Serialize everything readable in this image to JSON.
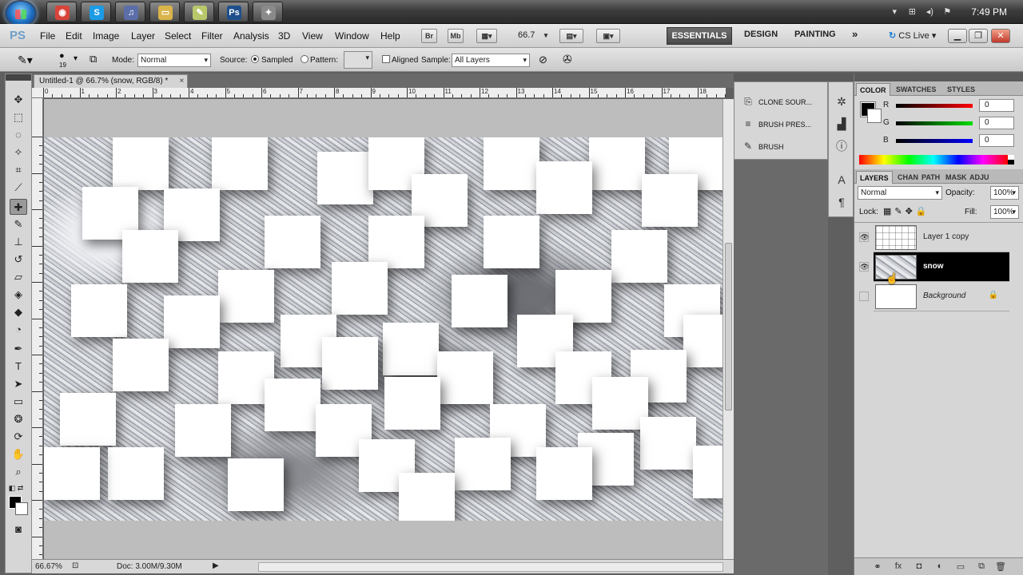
{
  "taskbar": {
    "clock": "7:49 PM",
    "apps": [
      {
        "icon": "chrome-icon",
        "color": "#d8443a",
        "glyph": "◉"
      },
      {
        "icon": "skype-icon",
        "color": "#1c9be6",
        "glyph": "S"
      },
      {
        "icon": "itunes-icon",
        "color": "#5b6ea8",
        "glyph": "♫"
      },
      {
        "icon": "folder-icon",
        "color": "#d9b44a",
        "glyph": "▭"
      },
      {
        "icon": "notes-icon",
        "color": "#b8c86a",
        "glyph": "✎"
      },
      {
        "icon": "photoshop-icon",
        "color": "#1e4f8c",
        "glyph": "Ps"
      },
      {
        "icon": "tool-icon",
        "color": "#8a8a8a",
        "glyph": "✦"
      }
    ]
  },
  "menubar": {
    "logo": "PS",
    "items": [
      "File",
      "Edit",
      "Image",
      "Layer",
      "Select",
      "Filter",
      "Analysis",
      "3D",
      "View",
      "Window",
      "Help"
    ],
    "bridge": "Br",
    "mini_bridge": "Mb",
    "zoom": "66.7",
    "workspaces": [
      "ESSENTIALS",
      "DESIGN",
      "PAINTING"
    ],
    "more": "»",
    "cs_live": "CS Live"
  },
  "options_bar": {
    "brush_size": "19",
    "mode_label": "Mode:",
    "mode_value": "Normal",
    "source_label": "Source:",
    "sampled_label": "Sampled",
    "pattern_label": "Pattern:",
    "aligned_label": "Aligned",
    "sample_label": "Sample:",
    "sample_value": "All Layers"
  },
  "document": {
    "tab_title": "Untitled-1 @ 66.7% (snow, RGB/8) *",
    "close": "×",
    "ruler_labels": [
      "0",
      "1",
      "2",
      "3",
      "4",
      "5",
      "6",
      "7",
      "8",
      "9",
      "10",
      "11",
      "12",
      "13",
      "14",
      "15",
      "16",
      "17",
      "18"
    ],
    "zoom_status": "66.67%",
    "doc_status": "Doc: 3.00M/9.30M"
  },
  "dock_mid": {
    "items": [
      {
        "label": "CLONE SOUR...",
        "icon": "clone-source-icon",
        "glyph": "⎘"
      },
      {
        "label": "BRUSH PRES...",
        "icon": "brush-presets-icon",
        "glyph": "≡"
      },
      {
        "label": "BRUSH",
        "icon": "brush-icon",
        "glyph": "✎"
      }
    ]
  },
  "color_panel": {
    "tabs": [
      "COLOR",
      "SWATCHES",
      "STYLES"
    ],
    "channels": [
      {
        "label": "R",
        "value": "0",
        "color": "#ff0000"
      },
      {
        "label": "G",
        "value": "0",
        "color": "#00dd00"
      },
      {
        "label": "B",
        "value": "0",
        "color": "#0000ff"
      }
    ]
  },
  "layers_panel": {
    "tabs": [
      "LAYERS",
      "CHAN",
      "PATH",
      "MASK",
      "ADJU"
    ],
    "blend_mode": "Normal",
    "opacity_label": "Opacity:",
    "opacity": "100%",
    "lock_label": "Lock:",
    "fill_label": "Fill:",
    "fill": "100%",
    "layers": [
      {
        "name": "Layer 1 copy",
        "visible": true,
        "selected": false,
        "locked": false,
        "thumb": "grid"
      },
      {
        "name": "snow",
        "visible": true,
        "selected": true,
        "locked": false,
        "thumb": "snowy"
      },
      {
        "name": "Background",
        "visible": false,
        "selected": false,
        "locked": true,
        "thumb": "white"
      }
    ]
  }
}
